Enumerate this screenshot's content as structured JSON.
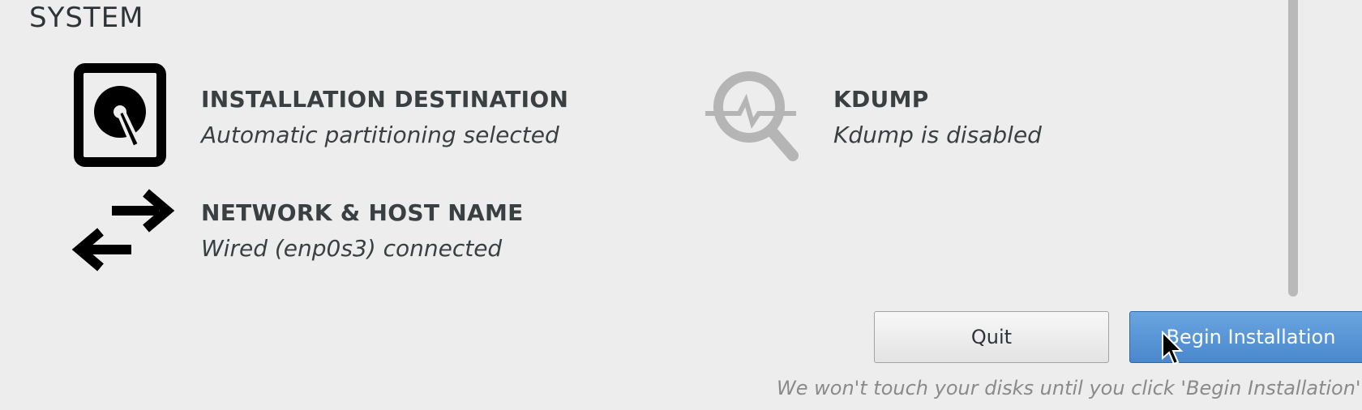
{
  "section": {
    "title": "SYSTEM"
  },
  "spokes": [
    {
      "title": "INSTALLATION DESTINATION",
      "status": "Automatic partitioning selected",
      "icon": "harddisk-icon"
    },
    {
      "title": "KDUMP",
      "status": "Kdump is disabled",
      "icon": "kdump-magnifier-icon"
    },
    {
      "title": "NETWORK & HOST NAME",
      "status": "Wired (enp0s3) connected",
      "icon": "network-arrows-icon"
    }
  ],
  "buttons": {
    "quit_label": "Quit",
    "begin_label": "Begin Installation"
  },
  "footnote": "We won't touch your disks until you click 'Begin Installation'.",
  "colors": {
    "background": "#ededed",
    "begin_button": "#4a88cd",
    "text": "#2e3436",
    "disabled_icon": "#b5b5b5"
  }
}
